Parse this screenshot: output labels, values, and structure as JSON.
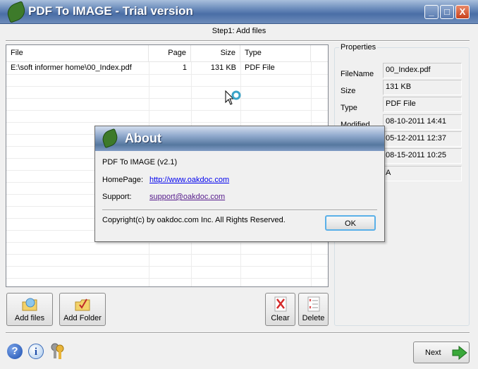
{
  "window": {
    "title": "PDF To IMAGE - Trial version",
    "min": "_",
    "max": "□",
    "close": "X"
  },
  "step_label": "Step1: Add files",
  "table": {
    "columns": [
      "File",
      "Page",
      "Size",
      "Type"
    ],
    "rows": [
      {
        "file": "E:\\soft informer home\\00_Index.pdf",
        "page": "1",
        "size": "131 KB",
        "type": "PDF File"
      }
    ]
  },
  "properties": {
    "title": "Properties",
    "labels": [
      "FileName",
      "Size",
      "Type",
      "Modified"
    ],
    "values": [
      "00_Index.pdf",
      "131 KB",
      "PDF File",
      "08-10-2011 14:41",
      "05-12-2011 12:37",
      "08-15-2011 10:25",
      "A"
    ]
  },
  "buttons": {
    "add_files": "Add files",
    "add_folder": "Add Folder",
    "clear": "Clear",
    "delete": "Delete",
    "next": "Next"
  },
  "about": {
    "title": "About",
    "product": "PDF To IMAGE (v2.1)",
    "homepage_label": "HomePage:",
    "homepage_url": "http://www.oakdoc.com",
    "support_label": "Support:",
    "support_email": "support@oakdoc.com",
    "copyright": "Copyright(c) by oakdoc.com Inc. All Rights Reserved.",
    "ok": "OK"
  },
  "icons": {
    "help": "?",
    "info": "i"
  }
}
